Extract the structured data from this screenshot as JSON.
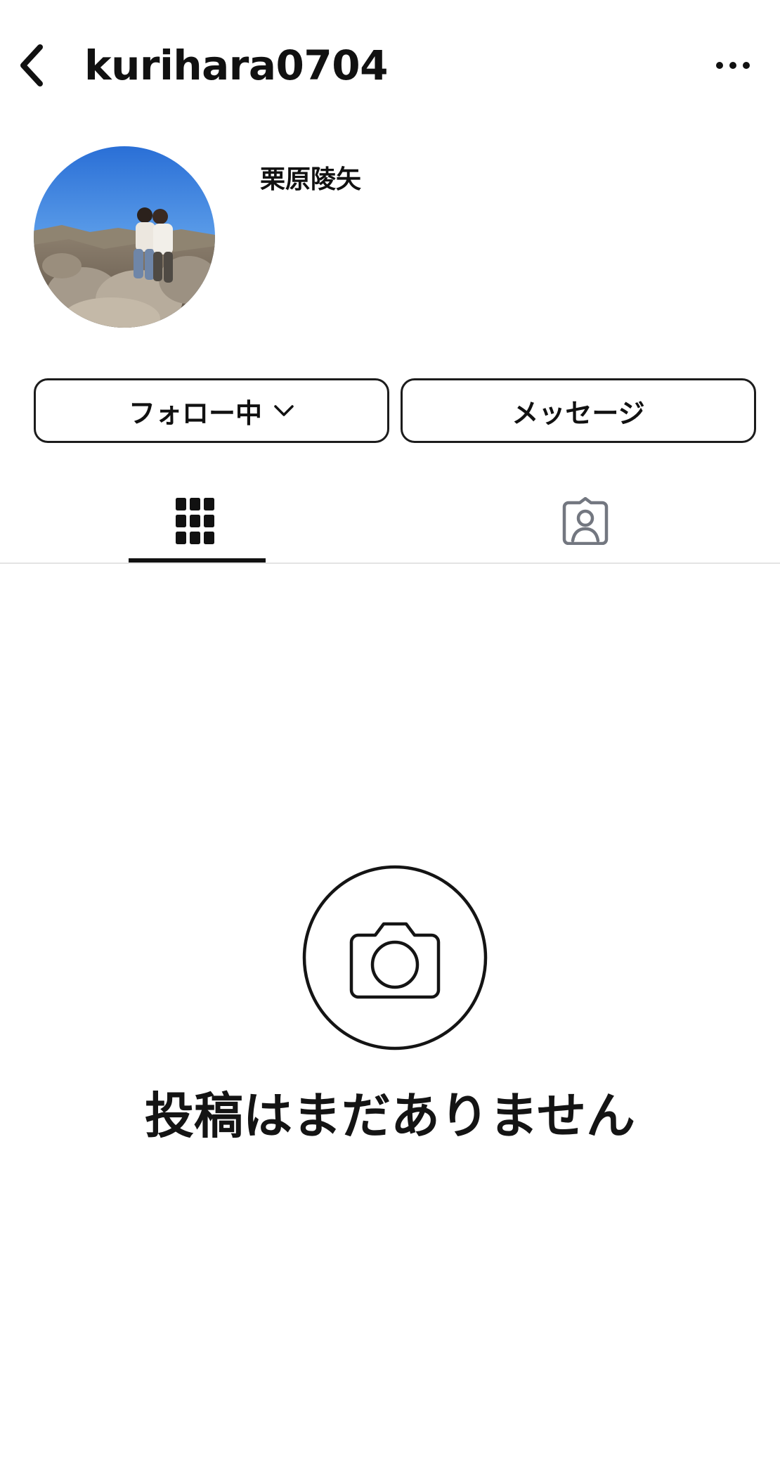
{
  "header": {
    "username": "kurihara0704",
    "back_icon": "chevron-left-icon",
    "more_icon": "more-horizontal-icon"
  },
  "profile": {
    "display_name": "栗原陵矢",
    "avatar_description": "profile photo"
  },
  "actions": {
    "follow_label": "フォロー中",
    "follow_icon": "chevron-down-icon",
    "message_label": "メッセージ"
  },
  "tabs": [
    {
      "name": "posts",
      "icon": "grid-icon",
      "active": true
    },
    {
      "name": "tagged",
      "icon": "tagged-person-icon",
      "active": false
    }
  ],
  "empty_state": {
    "icon": "camera-icon",
    "text": "投稿はまだありません"
  },
  "colors": {
    "text": "#111111",
    "border": "#1c1c1c",
    "inactive_icon": "#737780",
    "divider": "#e4e4e4",
    "background": "#ffffff"
  }
}
